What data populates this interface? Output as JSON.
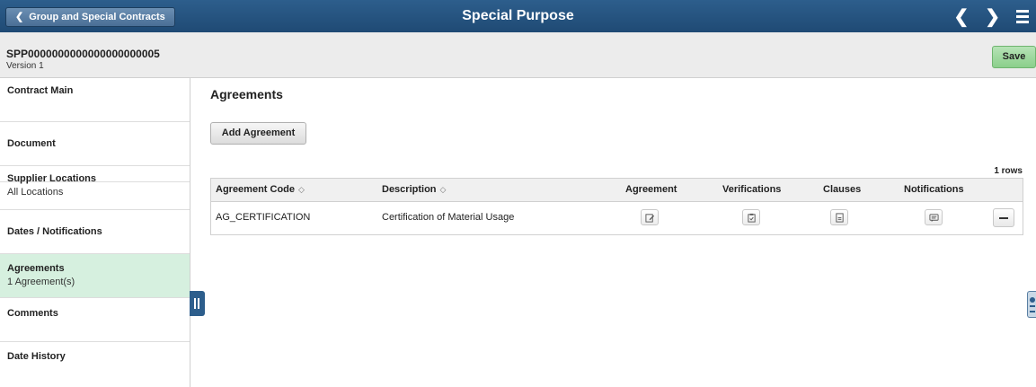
{
  "header": {
    "back_label": "Group and Special Contracts",
    "title": "Special Purpose"
  },
  "contract": {
    "id": "SPP0000000000000000000005",
    "version": "Version 1",
    "save_label": "Save"
  },
  "sidebar": {
    "items": [
      {
        "label": "Contract Main",
        "sub": ""
      },
      {
        "label": "Document",
        "sub": ""
      },
      {
        "label": "Supplier Locations",
        "sub": "All Locations"
      },
      {
        "label": "Dates / Notifications",
        "sub": ""
      },
      {
        "label": "Agreements",
        "sub": "1 Agreement(s)",
        "active": true
      },
      {
        "label": "Comments",
        "sub": ""
      },
      {
        "label": "Date History",
        "sub": ""
      }
    ]
  },
  "main": {
    "section_title": "Agreements",
    "add_label": "Add Agreement",
    "row_count": "1 rows",
    "columns": [
      "Agreement Code",
      "Description",
      "Agreement",
      "Verifications",
      "Clauses",
      "Notifications"
    ],
    "rows": [
      {
        "code": "AG_CERTIFICATION",
        "description": "Certification of Material Usage"
      }
    ]
  },
  "colors": {
    "topbar": "#2d5e8c",
    "active_item": "#d6f0df",
    "save_button": "#8bcf8b"
  }
}
